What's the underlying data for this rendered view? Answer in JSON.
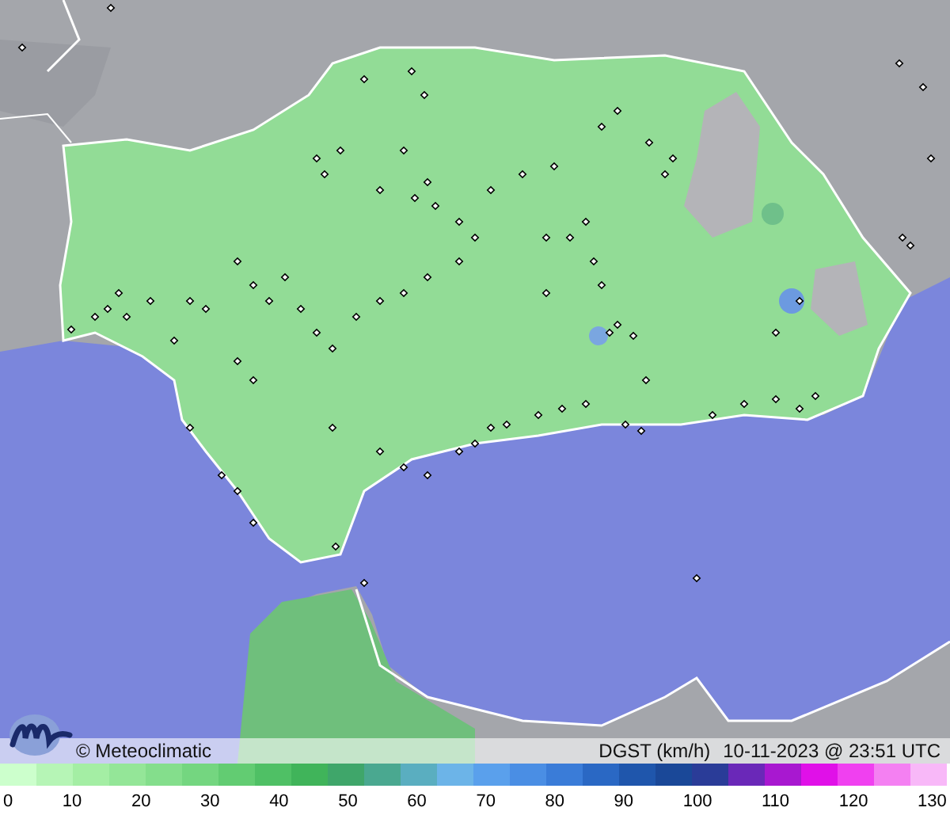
{
  "caption": {
    "copyright": "© Meteoclimatic",
    "variable": "DGST (km/h)",
    "timestamp": "10-11-2023 @ 23:51 UTC"
  },
  "legend": {
    "bands": [
      {
        "color": "#ccffcc"
      },
      {
        "color": "#b6f5b6"
      },
      {
        "color": "#a4eea4"
      },
      {
        "color": "#94e698"
      },
      {
        "color": "#84de8c"
      },
      {
        "color": "#74d680"
      },
      {
        "color": "#62cc72"
      },
      {
        "color": "#4fc065"
      },
      {
        "color": "#40b45a"
      },
      {
        "color": "#3fa66a"
      },
      {
        "color": "#4aa890"
      },
      {
        "color": "#5aaec0"
      },
      {
        "color": "#6cb4e8"
      },
      {
        "color": "#5aa0ec"
      },
      {
        "color": "#4a8ee4"
      },
      {
        "color": "#3a7cd8"
      },
      {
        "color": "#2a68c4"
      },
      {
        "color": "#1f56ac"
      },
      {
        "color": "#1a4898"
      },
      {
        "color": "#2a3c98"
      },
      {
        "color": "#6a28b8"
      },
      {
        "color": "#a818d0"
      },
      {
        "color": "#e010e8"
      },
      {
        "color": "#f040f0"
      },
      {
        "color": "#f480f2"
      },
      {
        "color": "#f8b8f8"
      }
    ],
    "labels": [
      "0",
      "10",
      "20",
      "30",
      "40",
      "50",
      "60",
      "70",
      "80",
      "90",
      "100",
      "110",
      "120",
      "130"
    ]
  }
}
